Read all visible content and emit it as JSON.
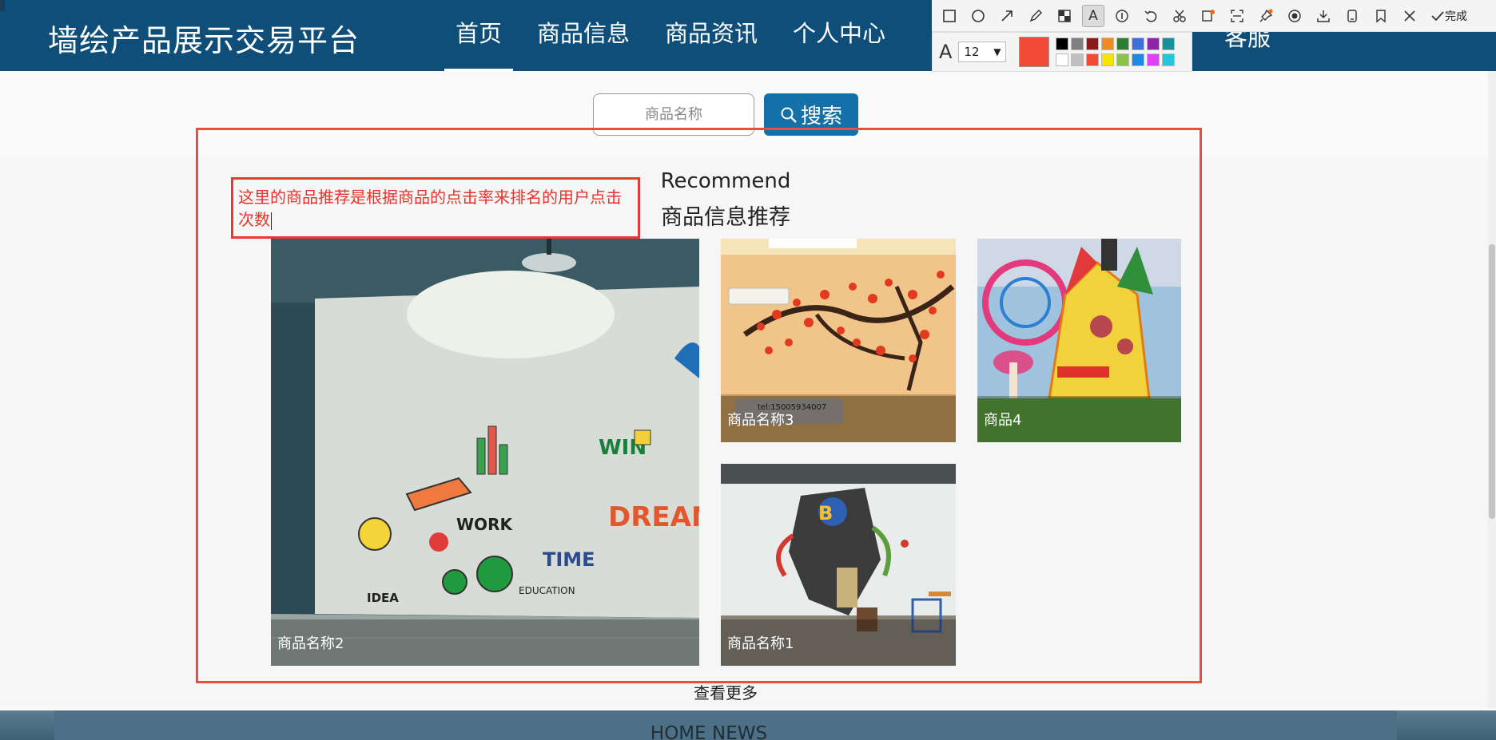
{
  "header": {
    "site_title": "墙绘产品展示交易平台",
    "nav": [
      "首页",
      "商品信息",
      "商品资讯",
      "个人中心"
    ],
    "extra_link": "客服"
  },
  "snip_toolbar": {
    "tools": [
      "rectangle-tool",
      "ellipse-tool",
      "arrow-tool",
      "pen-tool",
      "mosaic-tool",
      "text-tool",
      "number-tool",
      "undo-tool",
      "cut-tool",
      "ocr-tool",
      "scan-tool",
      "pin-tool",
      "record-tool",
      "download-tool",
      "long-screenshot-tool",
      "save-tool",
      "close-tool"
    ],
    "active_tool": "text-tool",
    "done_label": "完成",
    "text_icon": "A",
    "font_size": "12",
    "current_color": "#f24a34",
    "palette": [
      "#000000",
      "#808080",
      "#8b1a1a",
      "#f08a24",
      "#2e7d32",
      "#3f6fd8",
      "#8e24aa",
      "#1a8f9b",
      "#ffffff",
      "#c0c0c0",
      "#f24a34",
      "#f5e400",
      "#8bc34a",
      "#1e88e5",
      "#e040fb",
      "#26c6da"
    ]
  },
  "search": {
    "placeholder": "商品名称",
    "button_label": "搜索"
  },
  "section": {
    "title_en": "Recommend",
    "title_cn": "商品信息推荐"
  },
  "products": [
    {
      "name": "商品名称2",
      "image": "classroom-wall-doodle-mural"
    },
    {
      "name": "商品名称3",
      "image": "plum-blossom-wall-mural"
    },
    {
      "name": "商品4",
      "image": "fairy-castle-wall-mural"
    },
    {
      "name": "商品名称1",
      "image": "graffiti-3d-wall-mural"
    }
  ],
  "product_watermark": "tel:15005934007",
  "view_more": "查看更多",
  "news": {
    "title": "HOME NEWS"
  },
  "annotation": {
    "note": "这里的商品推荐是根据商品的点击率来排名的用户点击次数",
    "color": "#e8332a"
  }
}
